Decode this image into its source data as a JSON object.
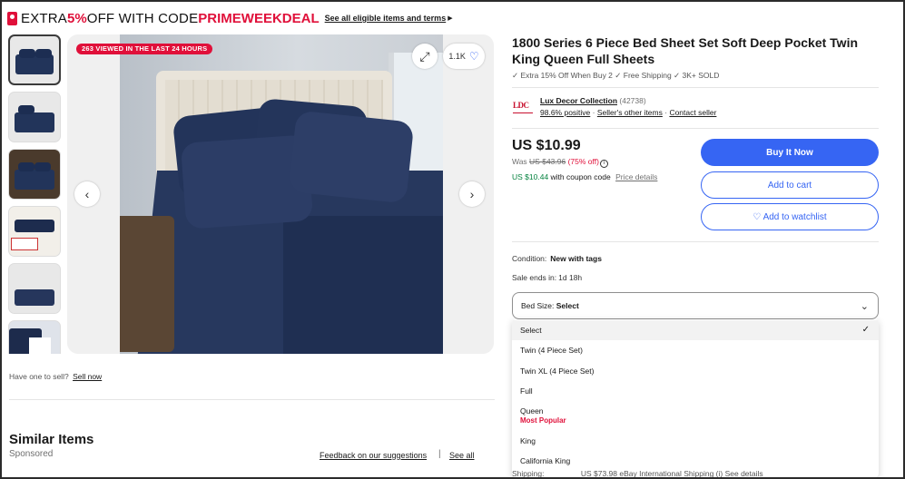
{
  "promo": {
    "text_main": "EXTRA ",
    "text_red1": "5%",
    "text_mid": " OFF WITH CODE ",
    "text_red2": "PRIMEWEEKDEAL",
    "link": "See all eligible items and terms"
  },
  "gallery": {
    "viewed_badge": "263 VIEWED IN THE LAST 24 HOURS",
    "watch_count": "1.1K",
    "thumbnails": [
      "thumb-1",
      "thumb-2",
      "thumb-3",
      "thumb-4",
      "thumb-5",
      "thumb-6"
    ]
  },
  "sell": {
    "prompt": "Have one to sell?",
    "link": "Sell now"
  },
  "similar": {
    "title": "Similar Items",
    "sponsored": "Sponsored",
    "feedback": "Feedback on our suggestions",
    "separator": "|",
    "see_all": "See all"
  },
  "product": {
    "title": "1800 Series 6 Piece Bed Sheet Set Soft Deep Pocket Twin King Queen Full Sheets",
    "subtitle": "✓ Extra 15% Off When Buy 2 ✓ Free Shipping ✓ 3K+ SOLD"
  },
  "seller": {
    "logo": "LDC",
    "name": "Lux Decor Collection",
    "count": "(42738)",
    "positive": "98.6% positive",
    "other_items": "Seller's other items",
    "contact": "Contact seller",
    "dot": " · "
  },
  "pricing": {
    "price": "US $10.99",
    "was_label": "Was ",
    "was_price": "US $43.96",
    "off": "(75% off)",
    "coupon_price": "US $10.44",
    "coupon_text": " with coupon code",
    "price_details": "Price details"
  },
  "actions": {
    "buy": "Buy It Now",
    "cart": "Add to cart",
    "watch": "♡ Add to watchlist"
  },
  "details": {
    "condition_label": "Condition:",
    "condition_value": "New with tags",
    "sale_label": "Sale ends in:",
    "sale_value": "1d 18h"
  },
  "size_select": {
    "label": "Bed Size: ",
    "value": "Select",
    "options": [
      {
        "label": "Select",
        "selected": true
      },
      {
        "label": "Twin (4 Piece Set)"
      },
      {
        "label": "Twin XL (4 Piece Set)"
      },
      {
        "label": "Full"
      },
      {
        "label": "Queen",
        "note": "Most Popular"
      },
      {
        "label": "King"
      },
      {
        "label": "California King"
      }
    ]
  },
  "shipping_peek": {
    "label": "Shipping:",
    "text": "US $73.98 eBay International Shipping (i)  See details"
  },
  "colors": {
    "accent": "#3665f3",
    "promo_red": "#e0103a",
    "coupon_green": "#05823f"
  }
}
